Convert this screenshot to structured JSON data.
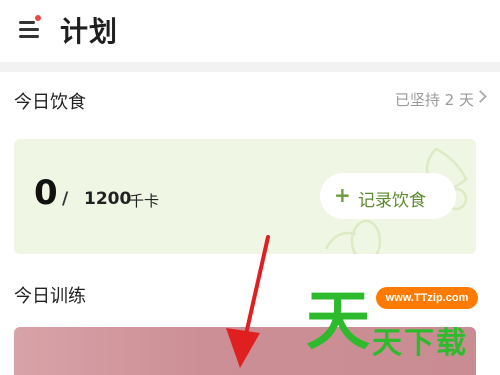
{
  "header": {
    "title": "计划",
    "menu_icon": "menu-icon",
    "notification_color": "#e24b4b"
  },
  "diet": {
    "title": "今日饮食",
    "streak": "已坚持 2 天",
    "calories_current": "0",
    "separator": "/",
    "calories_goal": "1200",
    "unit": "千卡",
    "log_button": "记录饮食",
    "card_color": "#f0f6e4",
    "accent_color": "#5c8a2e"
  },
  "training": {
    "title": "今日训练",
    "card_color": "#cc8f96"
  },
  "annotation": {
    "arrow_color": "#e02020"
  },
  "watermark": {
    "big_char": "天",
    "url": "www.TTzip.com",
    "name": "天下载",
    "color": "#2dbb2d",
    "url_bg": "#ff7a00"
  }
}
